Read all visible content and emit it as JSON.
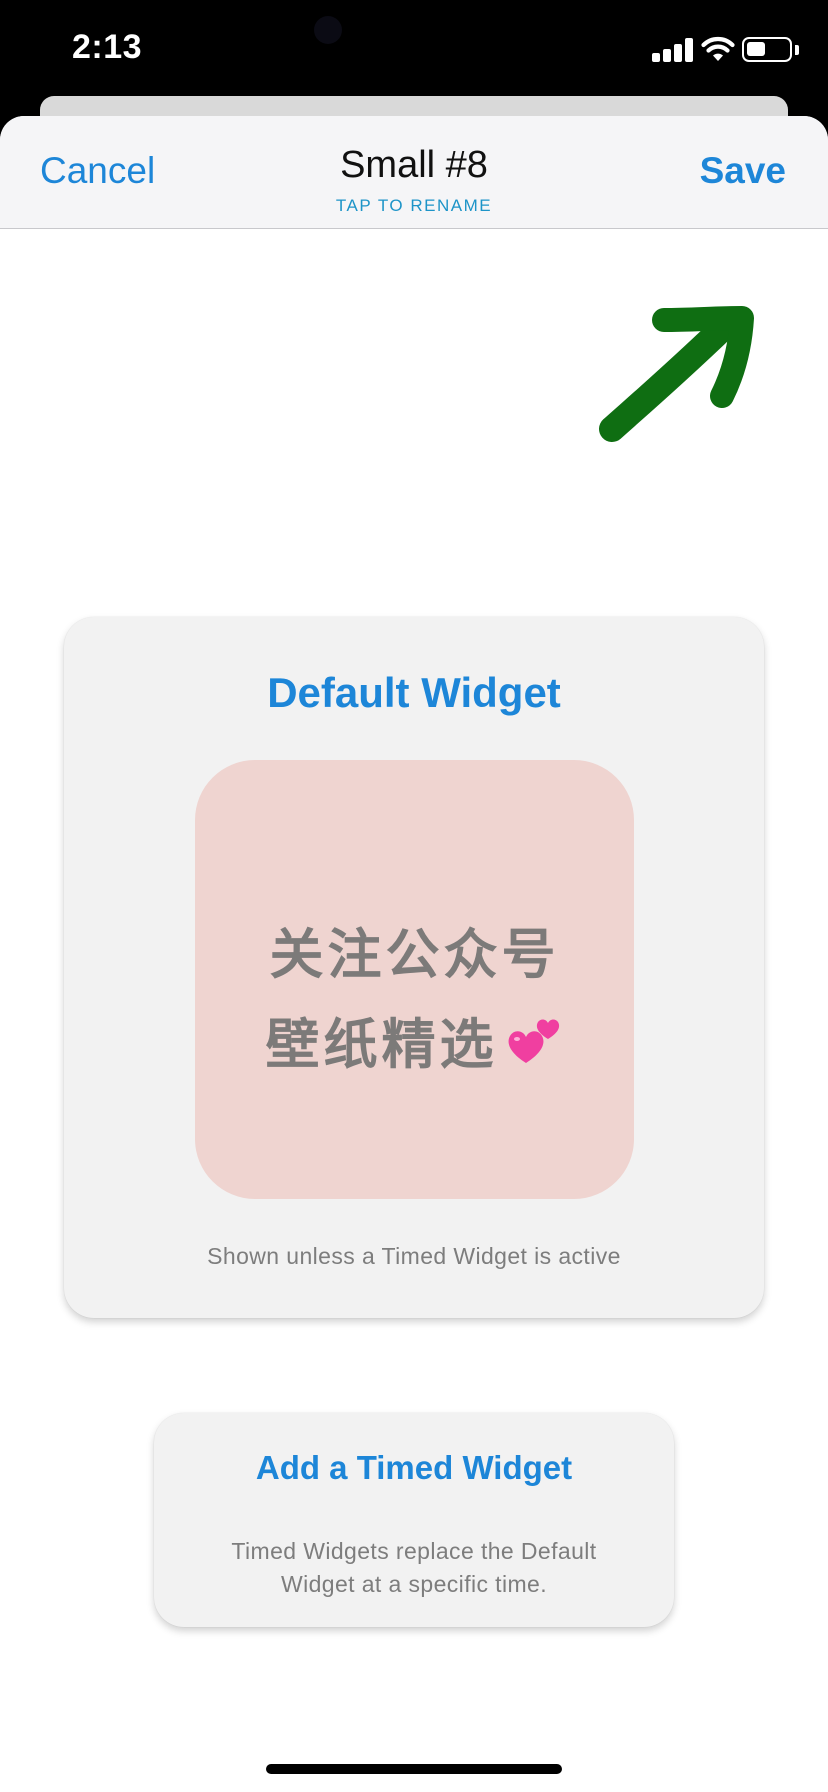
{
  "status_bar": {
    "time": "2:13"
  },
  "navbar": {
    "cancel_label": "Cancel",
    "title": "Small #8",
    "subtitle": "TAP TO RENAME",
    "save_label": "Save"
  },
  "default_card": {
    "title": "Default Widget",
    "widget_line1": "关注公众号",
    "widget_line2": "壁纸精选",
    "caption": "Shown unless a Timed Widget is active"
  },
  "timed_card": {
    "title": "Add a Timed Widget",
    "caption_line1": "Timed Widgets replace the Default",
    "caption_line2": "Widget at a specific time."
  },
  "icons": {
    "widget_emoji": "two-hearts-icon",
    "annotation": "green-arrow-icon"
  },
  "colors": {
    "accent": "#1d86d8",
    "widget_background": "#efd4d0",
    "annotation_arrow": "#0f6e12"
  }
}
